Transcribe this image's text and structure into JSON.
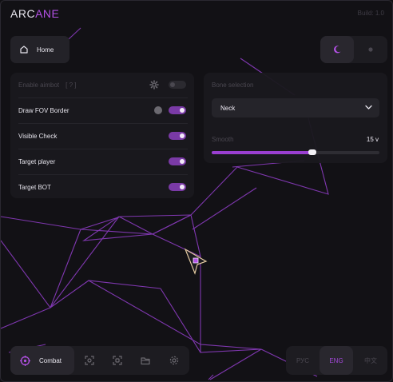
{
  "app": {
    "brand_prefix": "ARC",
    "brand_suffix": "ANE",
    "build": "Build: 1.0"
  },
  "nav": {
    "home_label": "Home",
    "combat_label": "Combat"
  },
  "aimbot": {
    "rows": [
      {
        "label": "Enable aimbot",
        "help": "[ ? ]",
        "enabled": false
      },
      {
        "label": "Draw FOV Border",
        "enabled": true
      },
      {
        "label": "Visible Check",
        "enabled": true
      },
      {
        "label": "Target player",
        "enabled": true
      },
      {
        "label": "Target BOT",
        "enabled": true
      }
    ]
  },
  "bone": {
    "label": "Bone selection",
    "selected": "Neck"
  },
  "smooth": {
    "label": "Smooth",
    "value_text": "15 v",
    "fraction": 0.6
  },
  "languages": {
    "items": [
      "РУС",
      "ENG",
      "中文"
    ],
    "active": "ENG"
  },
  "colors": {
    "accent": "#b451e6",
    "toggle_on": "#7a3aa6",
    "slider_fill": "#9a3fd1",
    "background": "#121115",
    "panel": "#1a191e"
  }
}
